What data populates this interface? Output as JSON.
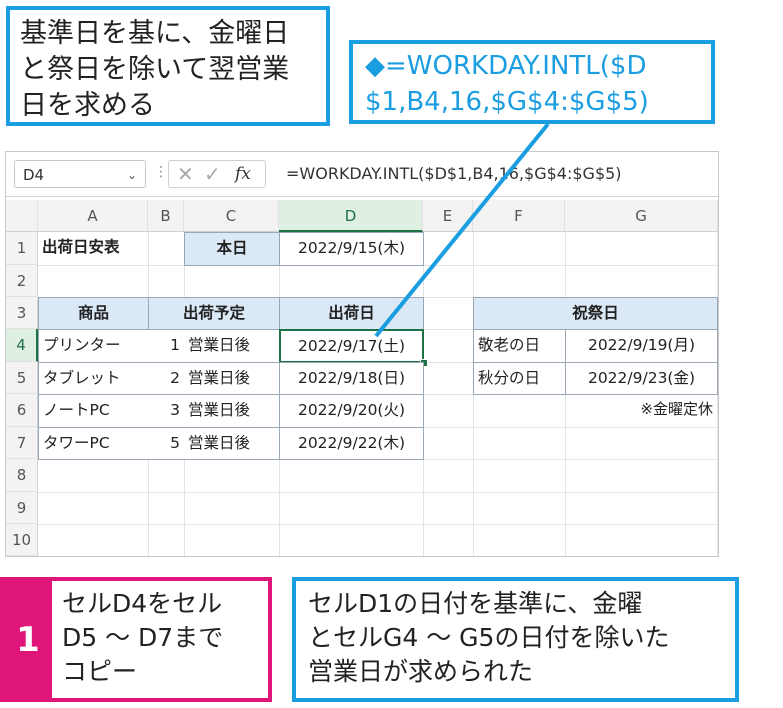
{
  "callouts": {
    "top_left": [
      "基準日を基に、金曜日",
      "と祭日を除いて翌営業",
      "日を求める"
    ],
    "formula": [
      "◆=WORKDAY.INTL($D",
      "$1,B4,16,$G$4:$G$5)"
    ],
    "step_number": "1",
    "step_text": [
      "セルD4をセル",
      "D5 ～ D7まで",
      "コピー"
    ],
    "result": [
      "セルD1の日付を基準に、金曜",
      "とセルG4 ～ G5の日付を除いた",
      "営業日が求められた"
    ]
  },
  "formula_bar": {
    "name_box": "D4",
    "name_box_arrow": "⌄",
    "separator": "⋮",
    "cancel_icon": "✕",
    "enter_icon": "✓",
    "fx_label": "fx",
    "formula": "=WORKDAY.INTL($D$1,B4,16,$G$4:$G$5)"
  },
  "columns": [
    "A",
    "B",
    "C",
    "D",
    "E",
    "F",
    "G"
  ],
  "rows": [
    "1",
    "2",
    "3",
    "4",
    "5",
    "6",
    "7",
    "8",
    "9",
    "10"
  ],
  "cells": {
    "A1": "出荷日安表",
    "C1": "本日",
    "D1": "2022/9/15(木)",
    "A3": "商品",
    "B3": "出荷予定",
    "D3": "出荷日",
    "F3": "祝祭日",
    "A4": "プリンター",
    "B4": "1",
    "C4": "営業日後",
    "D4": "2022/9/17(土)",
    "A5": "タブレット",
    "B5": "2",
    "C5": "営業日後",
    "D5": "2022/9/18(日)",
    "A6": "ノートPC",
    "B6": "3",
    "C6": "営業日後",
    "D6": "2022/9/20(火)",
    "A7": "タワーPC",
    "B7": "5",
    "C7": "営業日後",
    "D7": "2022/9/22(木)",
    "F4": "敬老の日",
    "G4": "2022/9/19(月)",
    "F5": "秋分の日",
    "G5": "2022/9/23(金)",
    "G6": "※金曜定休"
  },
  "selected_cell": "D4",
  "colors": {
    "callout_blue": "#1a9de1",
    "step_pink": "#e0157a",
    "header_fill": "#dbe9f6",
    "excel_green": "#1e7145"
  }
}
